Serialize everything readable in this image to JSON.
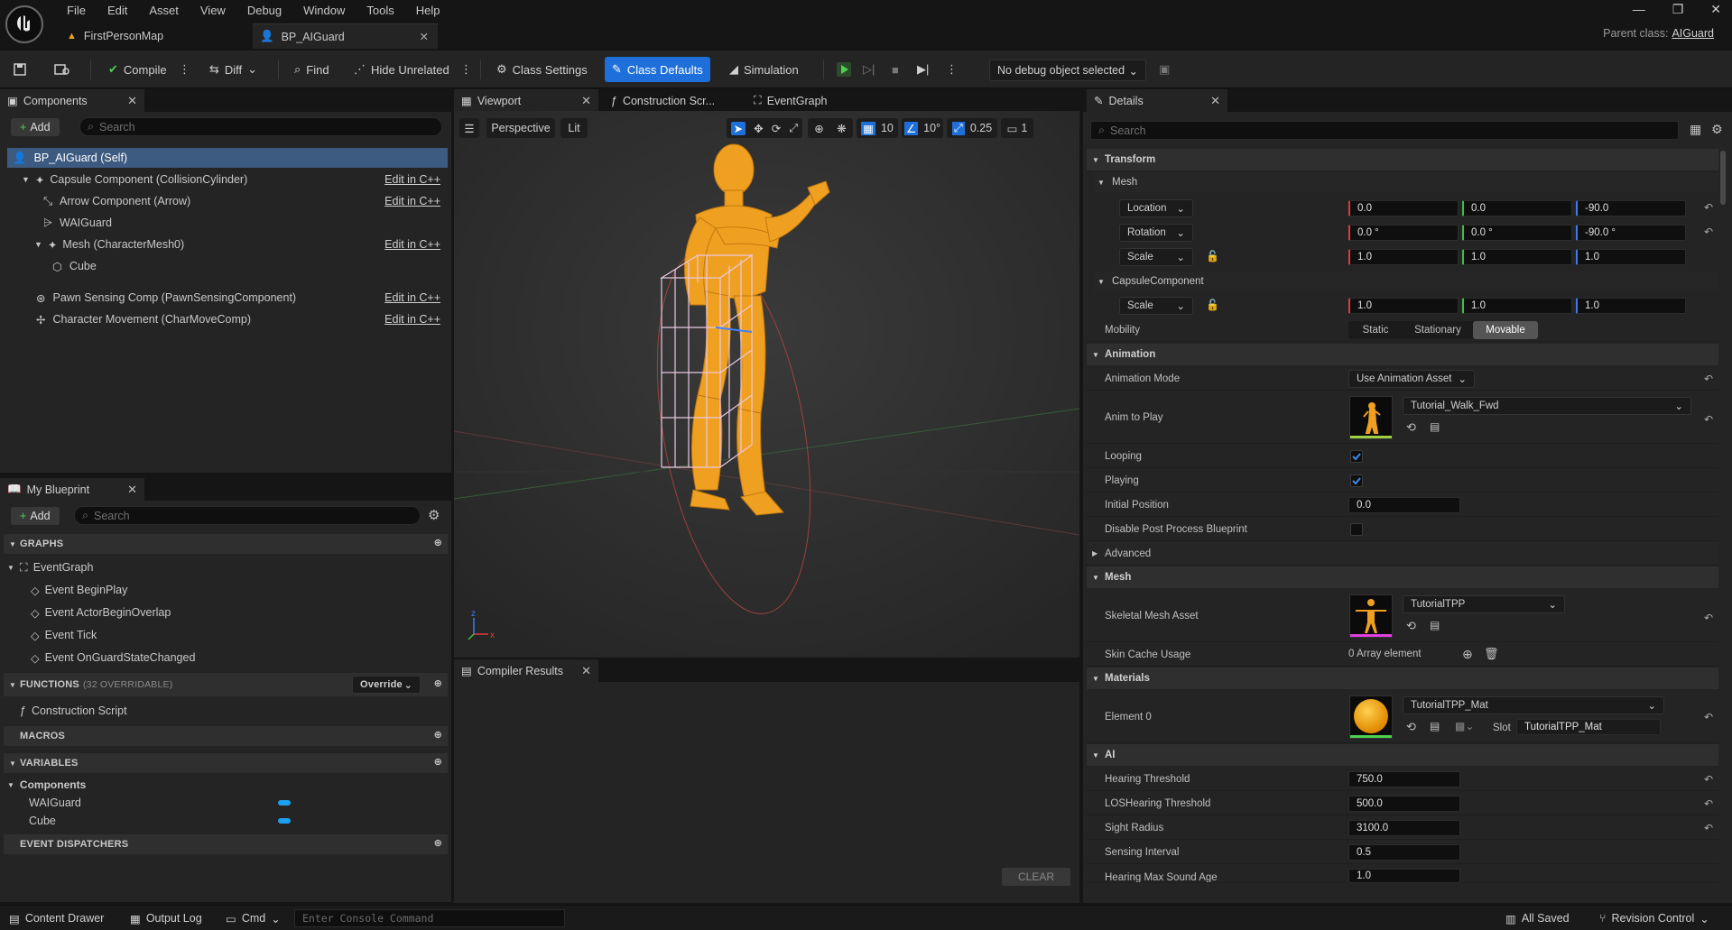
{
  "menu": [
    "File",
    "Edit",
    "Asset",
    "View",
    "Debug",
    "Window",
    "Tools",
    "Help"
  ],
  "doc_tabs": [
    {
      "label": "FirstPersonMap"
    },
    {
      "label": "BP_AIGuard"
    }
  ],
  "parent_class": {
    "label": "Parent class:",
    "value": "AIGuard"
  },
  "toolbar": {
    "compile": "Compile",
    "diff": "Diff",
    "find": "Find",
    "hide_unrelated": "Hide Unrelated",
    "class_settings": "Class Settings",
    "class_defaults": "Class Defaults",
    "simulation": "Simulation",
    "debug_object": "No debug object selected"
  },
  "components": {
    "tab": "Components",
    "add": "Add",
    "search_placeholder": "Search",
    "items": [
      {
        "label": "BP_AIGuard (Self)",
        "edit": ""
      },
      {
        "label": "Capsule Component (CollisionCylinder)",
        "edit": "Edit in C++"
      },
      {
        "label": "Arrow Component (Arrow)",
        "edit": "Edit in C++"
      },
      {
        "label": "WAIGuard",
        "edit": ""
      },
      {
        "label": "Mesh (CharacterMesh0)",
        "edit": "Edit in C++"
      },
      {
        "label": "Cube",
        "edit": ""
      },
      {
        "label": "Pawn Sensing Comp (PawnSensingComponent)",
        "edit": "Edit in C++"
      },
      {
        "label": "Character Movement (CharMoveComp)",
        "edit": "Edit in C++"
      }
    ]
  },
  "my_blueprint": {
    "tab": "My Blueprint",
    "add": "Add",
    "search_placeholder": "Search",
    "graphs": "GRAPHS",
    "event_graph": "EventGraph",
    "events": [
      "Event BeginPlay",
      "Event ActorBeginOverlap",
      "Event Tick",
      "Event OnGuardStateChanged"
    ],
    "functions": "FUNCTIONS",
    "functions_note": "(32 OVERRIDABLE)",
    "override": "Override",
    "construction_script": "Construction Script",
    "macros": "MACROS",
    "variables": "VARIABLES",
    "components_cat": "Components",
    "vars": [
      "WAIGuard",
      "Cube"
    ],
    "dispatchers": "EVENT DISPATCHERS"
  },
  "viewport": {
    "tabs": [
      "Viewport",
      "Construction Scr...",
      "EventGraph"
    ],
    "perspective": "Perspective",
    "lit": "Lit",
    "grid": "10",
    "angle": "10°",
    "scale": "0.25",
    "camera": "1"
  },
  "compiler": {
    "tab": "Compiler Results",
    "clear": "CLEAR"
  },
  "details": {
    "tab": "Details",
    "search_placeholder": "Search",
    "transform": "Transform",
    "mesh_sub": "Mesh",
    "location": {
      "label": "Location",
      "x": "0.0",
      "y": "0.0",
      "z": "-90.0"
    },
    "rotation": {
      "label": "Rotation",
      "x": "0.0 °",
      "y": "0.0 °",
      "z": "-90.0 °"
    },
    "scale": {
      "label": "Scale",
      "x": "1.0",
      "y": "1.0",
      "z": "1.0"
    },
    "capsule_sub": "CapsuleComponent",
    "capsule_scale": {
      "label": "Scale",
      "x": "1.0",
      "y": "1.0",
      "z": "1.0"
    },
    "mobility": {
      "label": "Mobility",
      "options": [
        "Static",
        "Stationary",
        "Movable"
      ],
      "selected": "Movable"
    },
    "animation": "Animation",
    "anim_mode": {
      "label": "Animation Mode",
      "value": "Use Animation Asset"
    },
    "anim_to_play": {
      "label": "Anim to Play",
      "value": "Tutorial_Walk_Fwd"
    },
    "looping": "Looping",
    "playing": "Playing",
    "initial_position": {
      "label": "Initial Position",
      "value": "0.0"
    },
    "disable_pp": "Disable Post Process Blueprint",
    "advanced": "Advanced",
    "mesh": "Mesh",
    "skeletal_mesh": {
      "label": "Skeletal Mesh Asset",
      "value": "TutorialTPP"
    },
    "skin_cache": {
      "label": "Skin Cache Usage",
      "value": "0 Array element"
    },
    "materials": "Materials",
    "element0": {
      "label": "Element 0",
      "value": "TutorialTPP_Mat",
      "slot_label": "Slot",
      "slot": "TutorialTPP_Mat"
    },
    "ai": "AI",
    "hearing_threshold": {
      "label": "Hearing Threshold",
      "value": "750.0"
    },
    "los_hearing": {
      "label": "LOSHearing Threshold",
      "value": "500.0"
    },
    "sight_radius": {
      "label": "Sight Radius",
      "value": "3100.0"
    },
    "sensing_interval": {
      "label": "Sensing Interval",
      "value": "0.5"
    },
    "hearing_max_age": {
      "label": "Hearing Max Sound Age",
      "value": "1.0"
    }
  },
  "statusbar": {
    "content_drawer": "Content Drawer",
    "output_log": "Output Log",
    "cmd": "Cmd",
    "console_placeholder": "Enter Console Command",
    "all_saved": "All Saved",
    "revision_control": "Revision Control"
  },
  "colors": {
    "accent": "#1e6fd9",
    "selection": "#3d5a80",
    "character": "#f0a020"
  }
}
